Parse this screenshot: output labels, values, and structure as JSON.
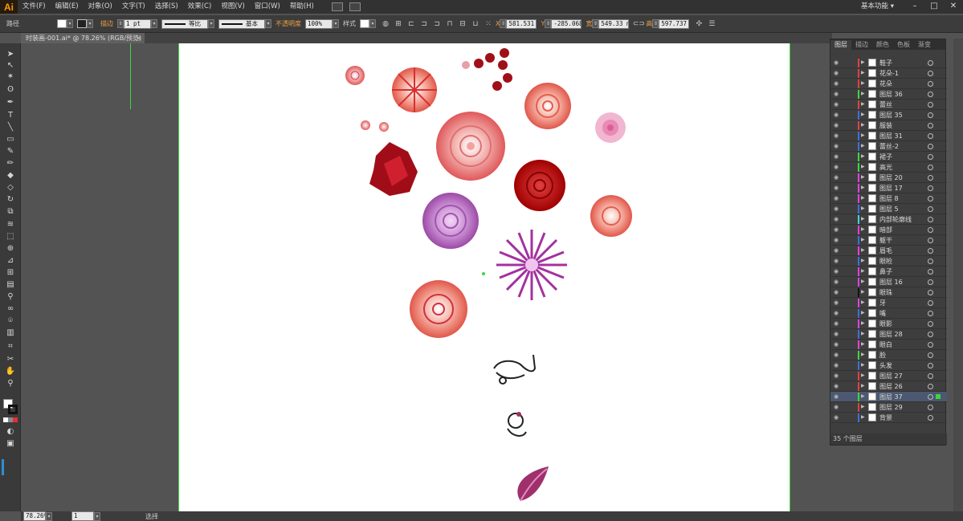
{
  "app": {
    "logo": "Ai",
    "workspace": "基本功能",
    "workspace_caret": "▾"
  },
  "menu": [
    "文件(F)",
    "编辑(E)",
    "对象(O)",
    "文字(T)",
    "选择(S)",
    "效果(C)",
    "视图(V)",
    "窗口(W)",
    "帮助(H)"
  ],
  "window_controls": {
    "minimize": "–",
    "maximize": "□",
    "close": "✕"
  },
  "control_bar": {
    "path_label": "路径",
    "stroke_label": "描边",
    "stroke_weight": "1 pt",
    "profile_label": "等比",
    "brush_label": "基本",
    "opacity_label": "不透明度",
    "opacity_value": "100%",
    "style_label": "样式",
    "x_label": "X",
    "x_value": "581.531",
    "y_label": "Y",
    "y_value": "-285.068",
    "w_label": "宽",
    "w_value": "549.33 m",
    "h_label": "高",
    "h_value": "597.737 r"
  },
  "document_tab": {
    "title": "时装画-001.ai* @ 78.26% (RGB/预览)",
    "close": "×"
  },
  "layers_panel": {
    "tabs": [
      "图层",
      "描边",
      "颜色",
      "色板",
      "渐变"
    ],
    "layers": [
      {
        "name": "鞋子",
        "color": "#e04040"
      },
      {
        "name": "花朵-1",
        "color": "#e04040"
      },
      {
        "name": "花朵",
        "color": "#e04040"
      },
      {
        "name": "图层 36",
        "color": "#3dd63d"
      },
      {
        "name": "蕾丝",
        "color": "#e04040"
      },
      {
        "name": "图层 35",
        "color": "#3d6de0"
      },
      {
        "name": "服装",
        "color": "#e04040"
      },
      {
        "name": "图层 31",
        "color": "#3d6de0"
      },
      {
        "name": "蕾丝-2",
        "color": "#3d6de0"
      },
      {
        "name": "裙子",
        "color": "#3dd63d"
      },
      {
        "name": "高光",
        "color": "#3dd63d"
      },
      {
        "name": "图层 20",
        "color": "#e040e0"
      },
      {
        "name": "图层 17",
        "color": "#e040e0"
      },
      {
        "name": "图层 8",
        "color": "#e040e0"
      },
      {
        "name": "图层 5",
        "color": "#3d6de0"
      },
      {
        "name": "内部轮廓线",
        "color": "#3dd6d6"
      },
      {
        "name": "暗部",
        "color": "#e040e0"
      },
      {
        "name": "躯干",
        "color": "#3d6de0"
      },
      {
        "name": "眉毛",
        "color": "#e040e0"
      },
      {
        "name": "眼睑",
        "color": "#3d6de0"
      },
      {
        "name": "鼻子",
        "color": "#e040e0"
      },
      {
        "name": "图层 16",
        "color": "#e040e0"
      },
      {
        "name": "眼珠",
        "color": "#111111"
      },
      {
        "name": "牙",
        "color": "#e040e0"
      },
      {
        "name": "嘴",
        "color": "#3d6de0"
      },
      {
        "name": "眼影",
        "color": "#e040e0"
      },
      {
        "name": "图层 28",
        "color": "#3d6de0"
      },
      {
        "name": "眼白",
        "color": "#e040e0"
      },
      {
        "name": "脸",
        "color": "#3dd63d"
      },
      {
        "name": "头发",
        "color": "#3d6de0"
      },
      {
        "name": "图层 27",
        "color": "#e04040"
      },
      {
        "name": "图层 26",
        "color": "#e04040"
      },
      {
        "name": "图层 37",
        "color": "#3dd63d",
        "selected": true
      },
      {
        "name": "图层 29",
        "color": "#e04040"
      },
      {
        "name": "背景",
        "color": "#3d6de0"
      }
    ],
    "footer_count": "35 个图层"
  },
  "status": {
    "zoom": "78.26%",
    "page": "1",
    "tool": "选择"
  },
  "colors": {
    "artboard_guide": "#3dd63d",
    "selection_accent": "#3dd63d"
  }
}
